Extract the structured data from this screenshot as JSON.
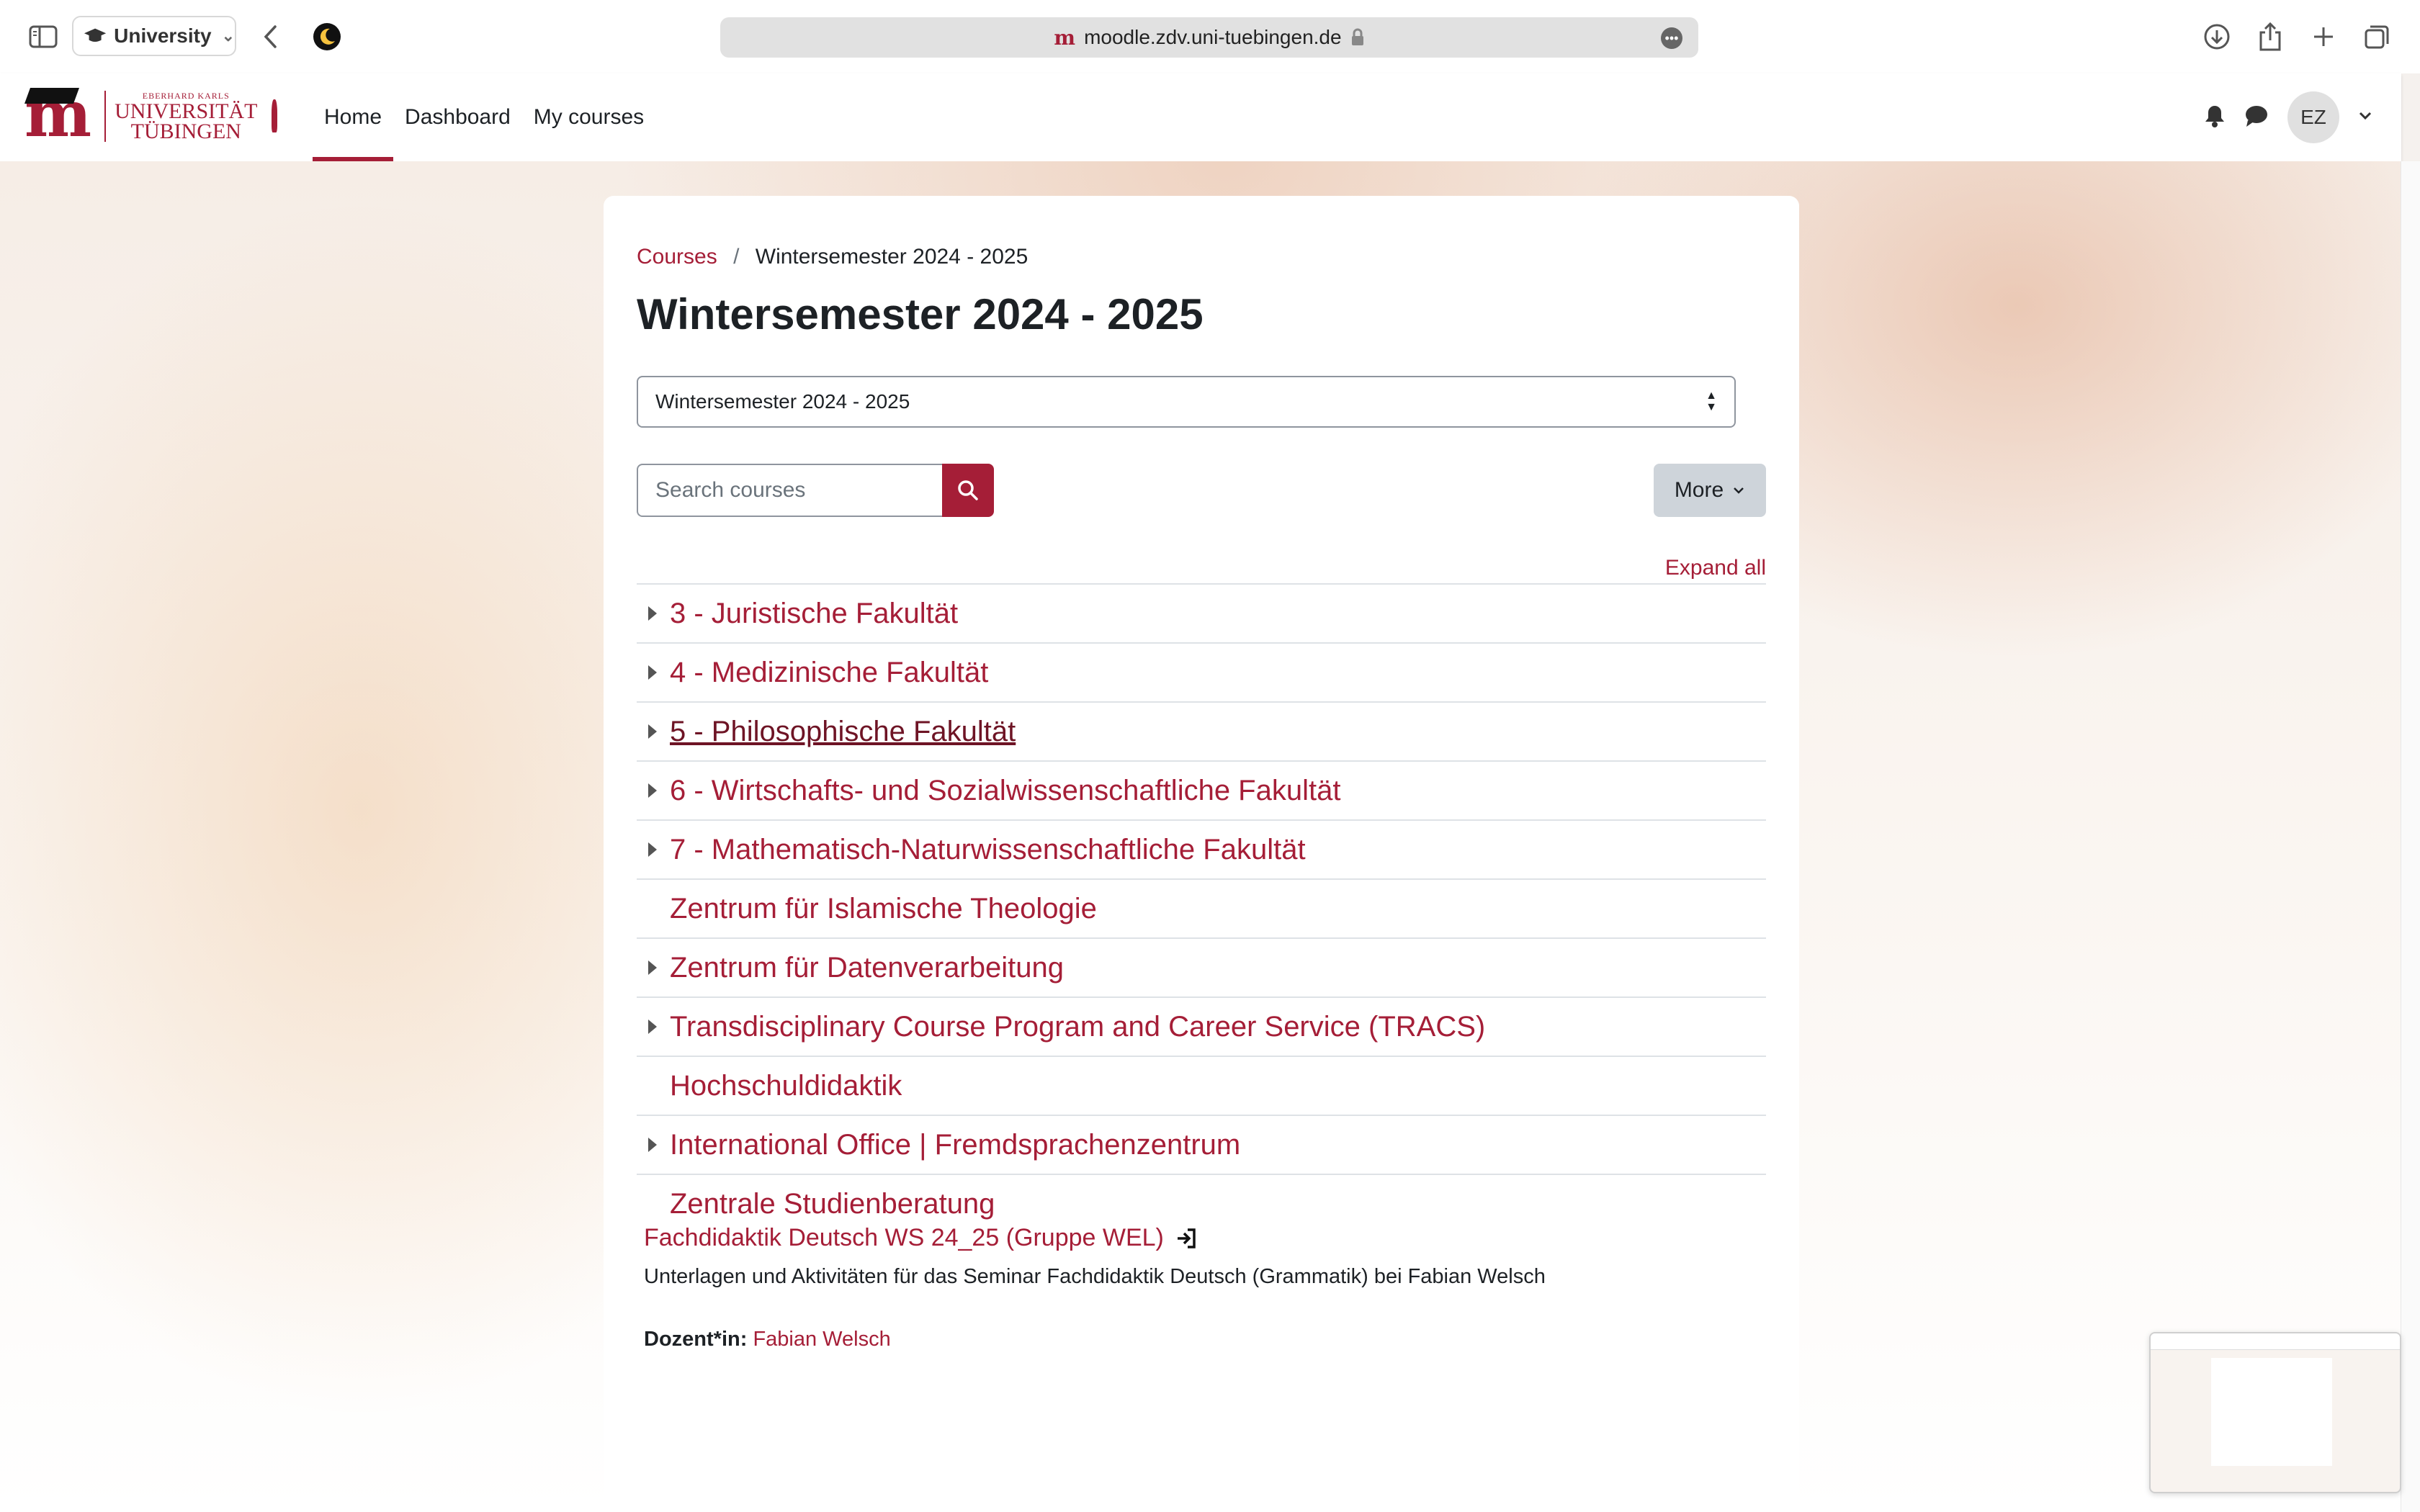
{
  "browser": {
    "profile_label": "University",
    "url": "moodle.zdv.uni-tuebingen.de"
  },
  "navbar": {
    "logo_top": "EBERHARD KARLS",
    "logo_line1": "UNIVERSITÄT",
    "logo_line2": "TÜBINGEN",
    "links": [
      "Home",
      "Dashboard",
      "My courses"
    ],
    "active_link": "Home",
    "user_initials": "EZ"
  },
  "breadcrumb": {
    "root": "Courses",
    "separator": "/",
    "current": "Wintersemester 2024 - 2025"
  },
  "page_title": "Wintersemester 2024 - 2025",
  "category_select": {
    "value": "Wintersemester 2024 - 2025"
  },
  "search": {
    "placeholder": "Search courses"
  },
  "more_label": "More",
  "expand_all_label": "Expand all",
  "categories": [
    {
      "label": "3 - Juristische Fakultät",
      "expandable": true
    },
    {
      "label": "4 - Medizinische Fakultät",
      "expandable": true
    },
    {
      "label": "5 - Philosophische Fakultät",
      "expandable": true
    },
    {
      "label": "6 - Wirtschafts- und Sozialwissenschaftliche Fakultät",
      "expandable": true
    },
    {
      "label": "7 - Mathematisch-Naturwissenschaftliche Fakultät",
      "expandable": true
    },
    {
      "label": "Zentrum für Islamische Theologie",
      "expandable": false
    },
    {
      "label": "Zentrum für Datenverarbeitung",
      "expandable": true
    },
    {
      "label": "Transdisciplinary Course Program and Career Service (TRACS)",
      "expandable": true
    },
    {
      "label": "Hochschuldidaktik",
      "expandable": false
    },
    {
      "label": "International Office | Fremdsprachenzentrum",
      "expandable": true
    },
    {
      "label": "Zentrale Studienberatung",
      "expandable": false
    }
  ],
  "course": {
    "name": "Fachdidaktik Deutsch WS 24_25 (Gruppe WEL)",
    "summary": "Unterlagen und Aktivitäten für das Seminar Fachdidaktik Deutsch (Grammatik) bei Fabian Welsch",
    "teacher_label": "Dozent*in:",
    "teacher_name": "Fabian Welsch"
  },
  "colors": {
    "accent": "#a51e37",
    "text": "#1d2125"
  }
}
